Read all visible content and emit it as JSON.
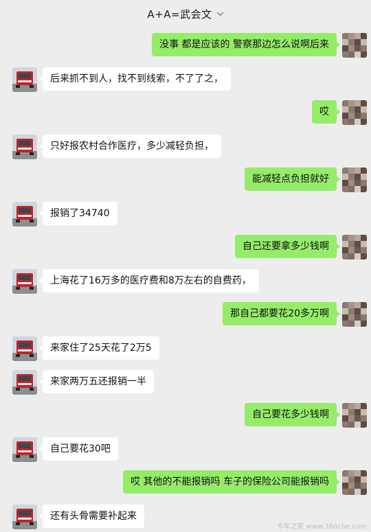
{
  "header": {
    "title": "A+A=武会文",
    "chevron_icon": "chevron-down-icon"
  },
  "colors": {
    "background": "#ededed",
    "self_bubble": "#95ec69",
    "other_bubble": "#ffffff"
  },
  "messages": [
    {
      "side": "right",
      "text": "没事  都是应该的  警察那边怎么说啊后来"
    },
    {
      "side": "left",
      "text": "后来抓不到人，找不到线索，不了了之，"
    },
    {
      "side": "right",
      "text": "哎"
    },
    {
      "side": "left",
      "text": "只好报农村合作医疗，多少减轻负担，"
    },
    {
      "side": "right",
      "text": "能减轻点负担就好"
    },
    {
      "side": "left",
      "text": "报销了34740"
    },
    {
      "side": "right",
      "text": "自己还要拿多少钱啊"
    },
    {
      "side": "left",
      "text": "上海花了16万多的医疗费和8万左右的自费药，"
    },
    {
      "side": "right",
      "text": "那自己都要花20多万啊"
    },
    {
      "side": "left",
      "text": "来家住了25天花了2万5"
    },
    {
      "side": "left",
      "text": "来家两万五还报销一半"
    },
    {
      "side": "right",
      "text": "自己要花多少钱啊"
    },
    {
      "side": "left",
      "text": "自己要花30吧"
    },
    {
      "side": "right",
      "text": "哎  其他的不能报销吗  车子的保险公司能报销吗"
    },
    {
      "side": "left",
      "text": "还有头骨需要补起来"
    }
  ],
  "watermark": "卡车之家 www.360che.com"
}
